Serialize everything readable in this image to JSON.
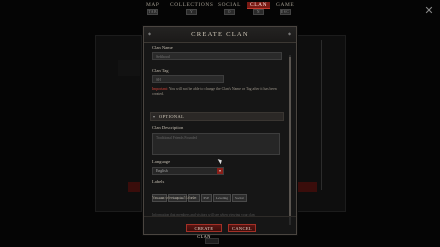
{
  "nav": {
    "tabs": [
      {
        "label": "MAP",
        "key": "TAB"
      },
      {
        "label": "COLLECTIONS",
        "key": "Y"
      },
      {
        "label": "SOCIAL",
        "key": "O"
      },
      {
        "label": "CLAN",
        "key": "N"
      },
      {
        "label": "GAME",
        "key": "ESC"
      }
    ],
    "active": "CLAN"
  },
  "dialog": {
    "title": "CREATE CLAN",
    "clan_name_label": "Clan Name",
    "clan_name_value": "Sefthood",
    "clan_tag_label": "Clan Tag",
    "clan_tag_value": "SH",
    "warning_prefix": "Important:",
    "warning_text": "You will not be able to change the Clan's Name or Tag after it has been created.",
    "optional_title": "OPTIONAL",
    "description_label": "Clan Description",
    "description_placeholder": "Traditional Friends Founded",
    "language_label": "Language",
    "language_value": "English",
    "labels_label": "Labels",
    "labels": [
      "Casual",
      "Hardcore",
      "PvE",
      "PvP",
      "Leveling",
      "Social"
    ],
    "labels_hint": "You can select up to 5 labels",
    "faded_text": "Information that members and visitors will see when viewing your clan",
    "create_button": "CREATE CLAN",
    "cancel_button": "CANCEL"
  },
  "colors": {
    "accent": "#a23027",
    "important": "#d4443a",
    "panel": "#161616"
  }
}
